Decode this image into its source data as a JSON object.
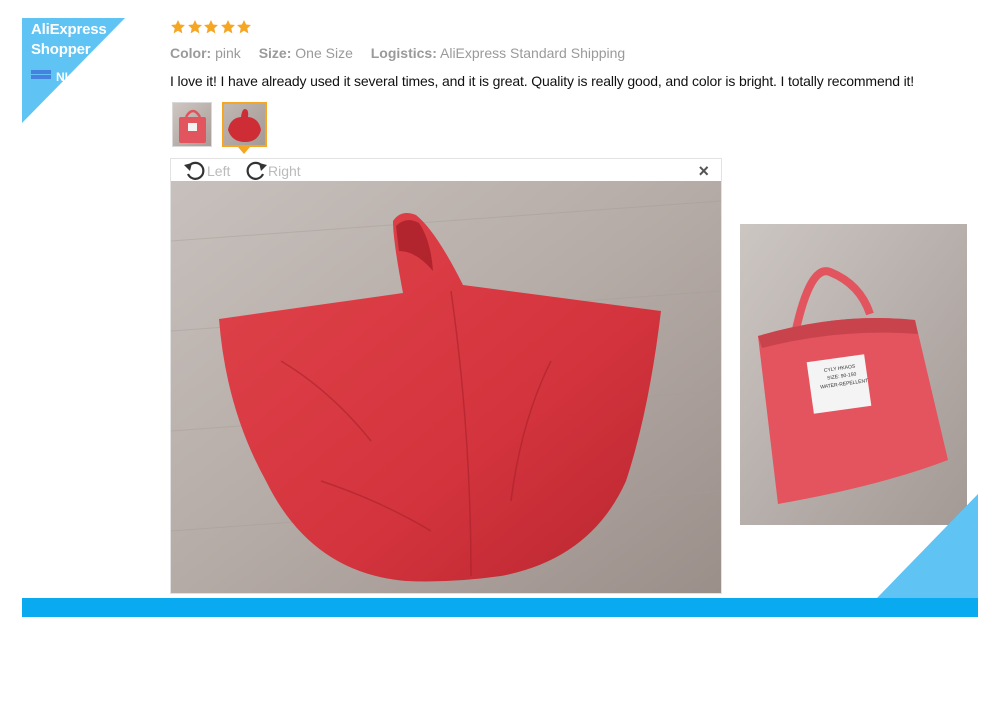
{
  "badge": {
    "line1": "AliExpress",
    "line2": "Shopper",
    "country": "NL",
    "flag_icon": "nl-flag-icon"
  },
  "rating": {
    "stars": 5,
    "max": 5,
    "color": "#f5a623"
  },
  "meta": {
    "color_label": "Color:",
    "color_value": "pink",
    "size_label": "Size:",
    "size_value": "One Size",
    "logistics_label": "Logistics:",
    "logistics_value": "AliExpress Standard Shipping"
  },
  "review_text": "I love it! I have already used it several times, and it is great. Quality is really good, and color is bright. I totally recommend it!",
  "thumbnails": [
    {
      "name": "folded-bag-thumbnail",
      "selected": false
    },
    {
      "name": "poncho-thumbnail",
      "selected": true
    }
  ],
  "viewer": {
    "rotate_left_label": "Left",
    "rotate_right_label": "Right",
    "close_icon": "×"
  },
  "label_tag": {
    "line1": "CYLY HKAOS",
    "line2": "SIZE: 90-150",
    "line3": "WATER-REPELLENT"
  },
  "colors": {
    "accent_blue": "#0aaaf0",
    "corner_blue": "#5fc3f3",
    "star_orange": "#f5a623",
    "raincoat_red": "#d9373f"
  }
}
